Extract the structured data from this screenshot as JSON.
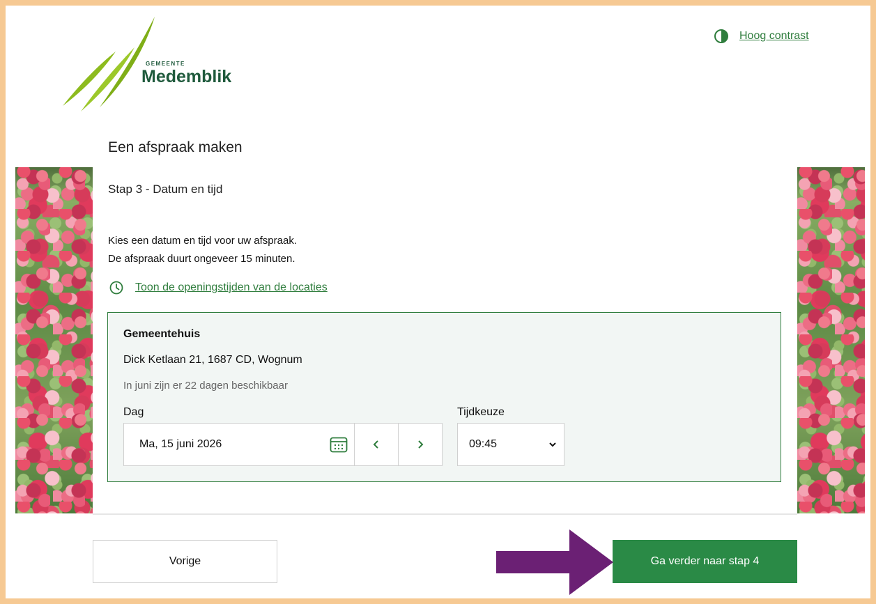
{
  "header": {
    "logo_small": "GEMEENTE",
    "logo_name": "Medemblik",
    "contrast_label": "Hoog contrast",
    "contrast_icon": "half-circle-icon"
  },
  "main": {
    "title": "Een afspraak maken",
    "step": "Stap 3 - Datum en tijd",
    "intro_line1": "Kies een datum en tijd voor uw afspraak.",
    "intro_line2": "De afspraak duurt ongeveer 15 minuten.",
    "hours_link": "Toon de openingstijden van de locaties",
    "hours_icon": "clock-icon"
  },
  "location": {
    "name": "Gemeentehuis",
    "address": "Dick Ketlaan 21, 1687 CD, Wognum",
    "availability": "In juni zijn er 22 dagen beschikbaar",
    "day_label": "Dag",
    "day_value": "Ma, 15 juni 2026",
    "calendar_icon": "calendar-icon",
    "prev_icon": "chevron-left-icon",
    "next_icon": "chevron-right-icon",
    "time_label": "Tijdkeuze",
    "time_value": "09:45",
    "time_icon": "chevron-down-icon"
  },
  "footer": {
    "prev_label": "Vorige",
    "next_label": "Ga verder naar stap 4"
  },
  "colors": {
    "accent": "#2f7d3d",
    "button": "#2a8a46",
    "frame": "#f6c993",
    "annotation_arrow": "#6b2074"
  }
}
